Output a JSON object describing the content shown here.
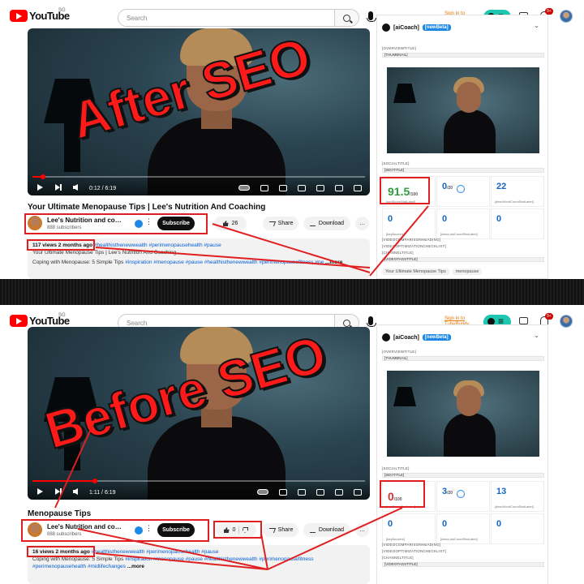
{
  "common": {
    "logo_text": "YouTube",
    "logo_region": "SG",
    "search_placeholder": "Search",
    "promo_line1": "Sign in to",
    "promo_line2": "TubeBuddy",
    "bell_badge": "9+",
    "channel_name": "Lee's Nutrition and coac...",
    "channel_subs": "888 subscribers",
    "subscribe": "Subscribe",
    "share": "Share",
    "download": "Download",
    "side_title": "[aiCoach]",
    "side_beta": "[newBeta]",
    "accent_red": "#ff0000",
    "accent_teal": "#1ec8b0"
  },
  "after": {
    "overlay": "After SEO",
    "time": "0:12 / 6:19",
    "progress": 0.032,
    "title": "Your Ultimate Menopause Tips | Lee's Nutrition And Coaching",
    "likes": "26",
    "views_meta": "117 views  2 months ago",
    "meta_tags": "#healthisthenewwealth #perimenopausehealth #pause",
    "desc_line1": "Your Ultimate Menopause Tips | Lee's Nutrition And Coaching",
    "desc_line2": "Coping with Menopause: 5 Simple Tips",
    "desc_tags": "#inspiration #menopause #pause #healthisthenewwealth #perimenopausefitness #pe",
    "more": "...more",
    "labels": [
      "[OVERVIEWTITLE]",
      "[THUMBNAIL]",
      "[SOCIALTITLE]",
      "[SEOTITLE]",
      "[VIDEOCOMPARISONHEADING]",
      "[VIDEOOPTIMIZATIONCHECKLIST]",
      "[CHANNELTITLE]",
      "[VIDEOTAGSTITLE]"
    ],
    "score_main": "91.5",
    "score_main_denom": "/100",
    "score_main_label": "[seoScoreStatLabel]",
    "score_b": "0",
    "score_b_denom": "/20",
    "score_c": "22",
    "score_c_label": "[descWordCountStatLabel]",
    "score_d": "0",
    "score_d_label": "[keyBuzzers]",
    "score_e": "0",
    "score_e_label": "[descLinkCountStatLabel]",
    "score_f": "0",
    "tags": [
      "Your Ultimate Menopause Tips",
      "menopause"
    ]
  },
  "before": {
    "overlay": "Before SEO",
    "time": "1:11 / 6:19",
    "progress": 0.187,
    "title": "Menopause Tips",
    "likes": "0",
    "views_meta": "16 views  2 months ago",
    "meta_tags": "#healthisthenewwealth #perimenopausehealth #pause",
    "desc_line1": "Coping with Menopause: 5 Simple Tips",
    "desc_tags": "#inspiration #menopause #pause #healthisthenewwealth #perimenopausefitness",
    "desc_tags2": "#perimenopausehealth #midlifechanges",
    "more": "...more",
    "labels": [
      "[OVERVIEWTITLE]",
      "[THUMBNAIL]",
      "[SOCIALTITLE]",
      "[SEOTITLE]",
      "[VIDEOCOMPARISONHEADING]",
      "[VIDEOOPTIMIZATIONCHECKLIST]",
      "[CHANNELTITLE]",
      "[VIDEOTAGSTITLE]"
    ],
    "score_main": "0",
    "score_main_denom": "/100",
    "score_main_label": "[seoScoreStatLabel]",
    "score_b": "3",
    "score_b_denom": "/20",
    "score_c": "13",
    "score_c_label": "[descWordCountStatLabel]",
    "score_d": "0",
    "score_d_label": "[keyBuzzers]",
    "score_e": "0",
    "score_e_label": "[descLinkCountStatLabel]",
    "score_f": "0"
  }
}
